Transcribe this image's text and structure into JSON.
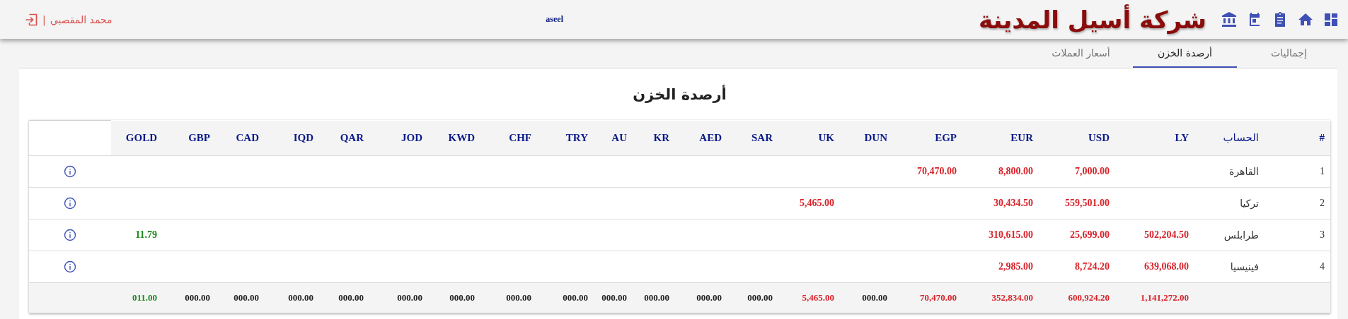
{
  "header": {
    "company_title": "شركة أسيل المدينة",
    "username": "aseel",
    "user_name": "محمد المقصبي",
    "separator": "|"
  },
  "tabs": [
    {
      "label": "إجماليات",
      "selected": false
    },
    {
      "label": "أرصدة الخزن",
      "selected": true
    },
    {
      "label": "أسعار العملات",
      "selected": false
    }
  ],
  "card": {
    "title": "أرصدة الخزن"
  },
  "table": {
    "columns": [
      {
        "kind": "action"
      },
      {
        "label": "GOLD",
        "kind": "metal"
      },
      {
        "label": "GBP",
        "kind": "currency"
      },
      {
        "label": "CAD",
        "kind": "currency"
      },
      {
        "label": "IQD",
        "kind": "currency"
      },
      {
        "label": "QAR",
        "kind": "currency"
      },
      {
        "label": "JOD",
        "kind": "currency"
      },
      {
        "label": "KWD",
        "kind": "currency"
      },
      {
        "label": "CHF",
        "kind": "currency"
      },
      {
        "label": "TRY",
        "kind": "currency"
      },
      {
        "label": "AU",
        "kind": "currency"
      },
      {
        "label": "KR",
        "kind": "currency"
      },
      {
        "label": "AED",
        "kind": "currency"
      },
      {
        "label": "SAR",
        "kind": "currency"
      },
      {
        "label": "UK",
        "kind": "currency"
      },
      {
        "label": "DUN",
        "kind": "currency"
      },
      {
        "label": "EGP",
        "kind": "currency"
      },
      {
        "label": "EUR",
        "kind": "currency"
      },
      {
        "label": "USD",
        "kind": "currency"
      },
      {
        "label": "LY",
        "kind": "currency"
      },
      {
        "label": "الحساب",
        "kind": "account"
      },
      {
        "label": "#",
        "kind": "index"
      }
    ],
    "rows": [
      {
        "number": "1",
        "account": "القاهرة",
        "amounts": [
          {
            "kind": "empty"
          },
          {
            "kind": "empty"
          },
          {
            "kind": "empty"
          },
          {
            "kind": "empty"
          },
          {
            "kind": "empty"
          },
          {
            "kind": "empty"
          },
          {
            "kind": "empty"
          },
          {
            "kind": "empty"
          },
          {
            "kind": "empty"
          },
          {
            "kind": "empty"
          },
          {
            "kind": "empty"
          },
          {
            "kind": "empty"
          },
          {
            "kind": "empty"
          },
          {
            "kind": "empty"
          },
          {
            "kind": "empty"
          },
          {
            "kind": "amount",
            "value": "70,470.00"
          },
          {
            "kind": "amount",
            "value": "8,800.00"
          },
          {
            "kind": "amount",
            "value": "7,000.00"
          },
          {
            "kind": "empty"
          }
        ]
      },
      {
        "number": "2",
        "account": "تركيا",
        "amounts": [
          {
            "kind": "empty"
          },
          {
            "kind": "empty"
          },
          {
            "kind": "empty"
          },
          {
            "kind": "empty"
          },
          {
            "kind": "empty"
          },
          {
            "kind": "empty"
          },
          {
            "kind": "empty"
          },
          {
            "kind": "empty"
          },
          {
            "kind": "empty"
          },
          {
            "kind": "empty"
          },
          {
            "kind": "empty"
          },
          {
            "kind": "empty"
          },
          {
            "kind": "empty"
          },
          {
            "kind": "amount",
            "value": "5,465.00"
          },
          {
            "kind": "empty"
          },
          {
            "kind": "empty"
          },
          {
            "kind": "amount",
            "value": "30,434.50"
          },
          {
            "kind": "amount",
            "value": "559,501.00"
          },
          {
            "kind": "empty"
          }
        ]
      },
      {
        "number": "3",
        "account": "طرابلس",
        "amounts": [
          {
            "kind": "amount",
            "value": "11.79"
          },
          {
            "kind": "empty"
          },
          {
            "kind": "empty"
          },
          {
            "kind": "empty"
          },
          {
            "kind": "empty"
          },
          {
            "kind": "empty"
          },
          {
            "kind": "empty"
          },
          {
            "kind": "empty"
          },
          {
            "kind": "empty"
          },
          {
            "kind": "empty"
          },
          {
            "kind": "empty"
          },
          {
            "kind": "empty"
          },
          {
            "kind": "empty"
          },
          {
            "kind": "empty"
          },
          {
            "kind": "empty"
          },
          {
            "kind": "empty"
          },
          {
            "kind": "amount",
            "value": "310,615.00"
          },
          {
            "kind": "amount",
            "value": "25,699.00"
          },
          {
            "kind": "amount",
            "value": "502,204.50"
          }
        ]
      },
      {
        "number": "4",
        "account": "فينيسيا",
        "amounts": [
          {
            "kind": "empty"
          },
          {
            "kind": "empty"
          },
          {
            "kind": "empty"
          },
          {
            "kind": "empty"
          },
          {
            "kind": "empty"
          },
          {
            "kind": "empty"
          },
          {
            "kind": "empty"
          },
          {
            "kind": "empty"
          },
          {
            "kind": "empty"
          },
          {
            "kind": "empty"
          },
          {
            "kind": "empty"
          },
          {
            "kind": "empty"
          },
          {
            "kind": "empty"
          },
          {
            "kind": "empty"
          },
          {
            "kind": "empty"
          },
          {
            "kind": "empty"
          },
          {
            "kind": "amount",
            "value": "2,985.00"
          },
          {
            "kind": "amount",
            "value": "8,724.20"
          },
          {
            "kind": "amount",
            "value": "639,068.00"
          }
        ]
      }
    ],
    "totals": [
      {
        "value": "011.00",
        "kind": "amount"
      },
      {
        "value": "000.00",
        "kind": "zero"
      },
      {
        "value": "000.00",
        "kind": "zero"
      },
      {
        "value": "000.00",
        "kind": "zero"
      },
      {
        "value": "000.00",
        "kind": "zero"
      },
      {
        "value": "000.00",
        "kind": "zero"
      },
      {
        "value": "000.00",
        "kind": "zero"
      },
      {
        "value": "000.00",
        "kind": "zero"
      },
      {
        "value": "000.00",
        "kind": "zero"
      },
      {
        "value": "000.00",
        "kind": "zero"
      },
      {
        "value": "000.00",
        "kind": "zero"
      },
      {
        "value": "000.00",
        "kind": "zero"
      },
      {
        "value": "000.00",
        "kind": "zero"
      },
      {
        "value": "5,465.00",
        "kind": "amount"
      },
      {
        "value": "000.00",
        "kind": "zero"
      },
      {
        "value": "70,470.00",
        "kind": "amount"
      },
      {
        "value": "352,834.00",
        "kind": "amount"
      },
      {
        "value": "600,924.20",
        "kind": "amount"
      },
      {
        "value": "1,141,272.00",
        "kind": "amount"
      }
    ]
  }
}
